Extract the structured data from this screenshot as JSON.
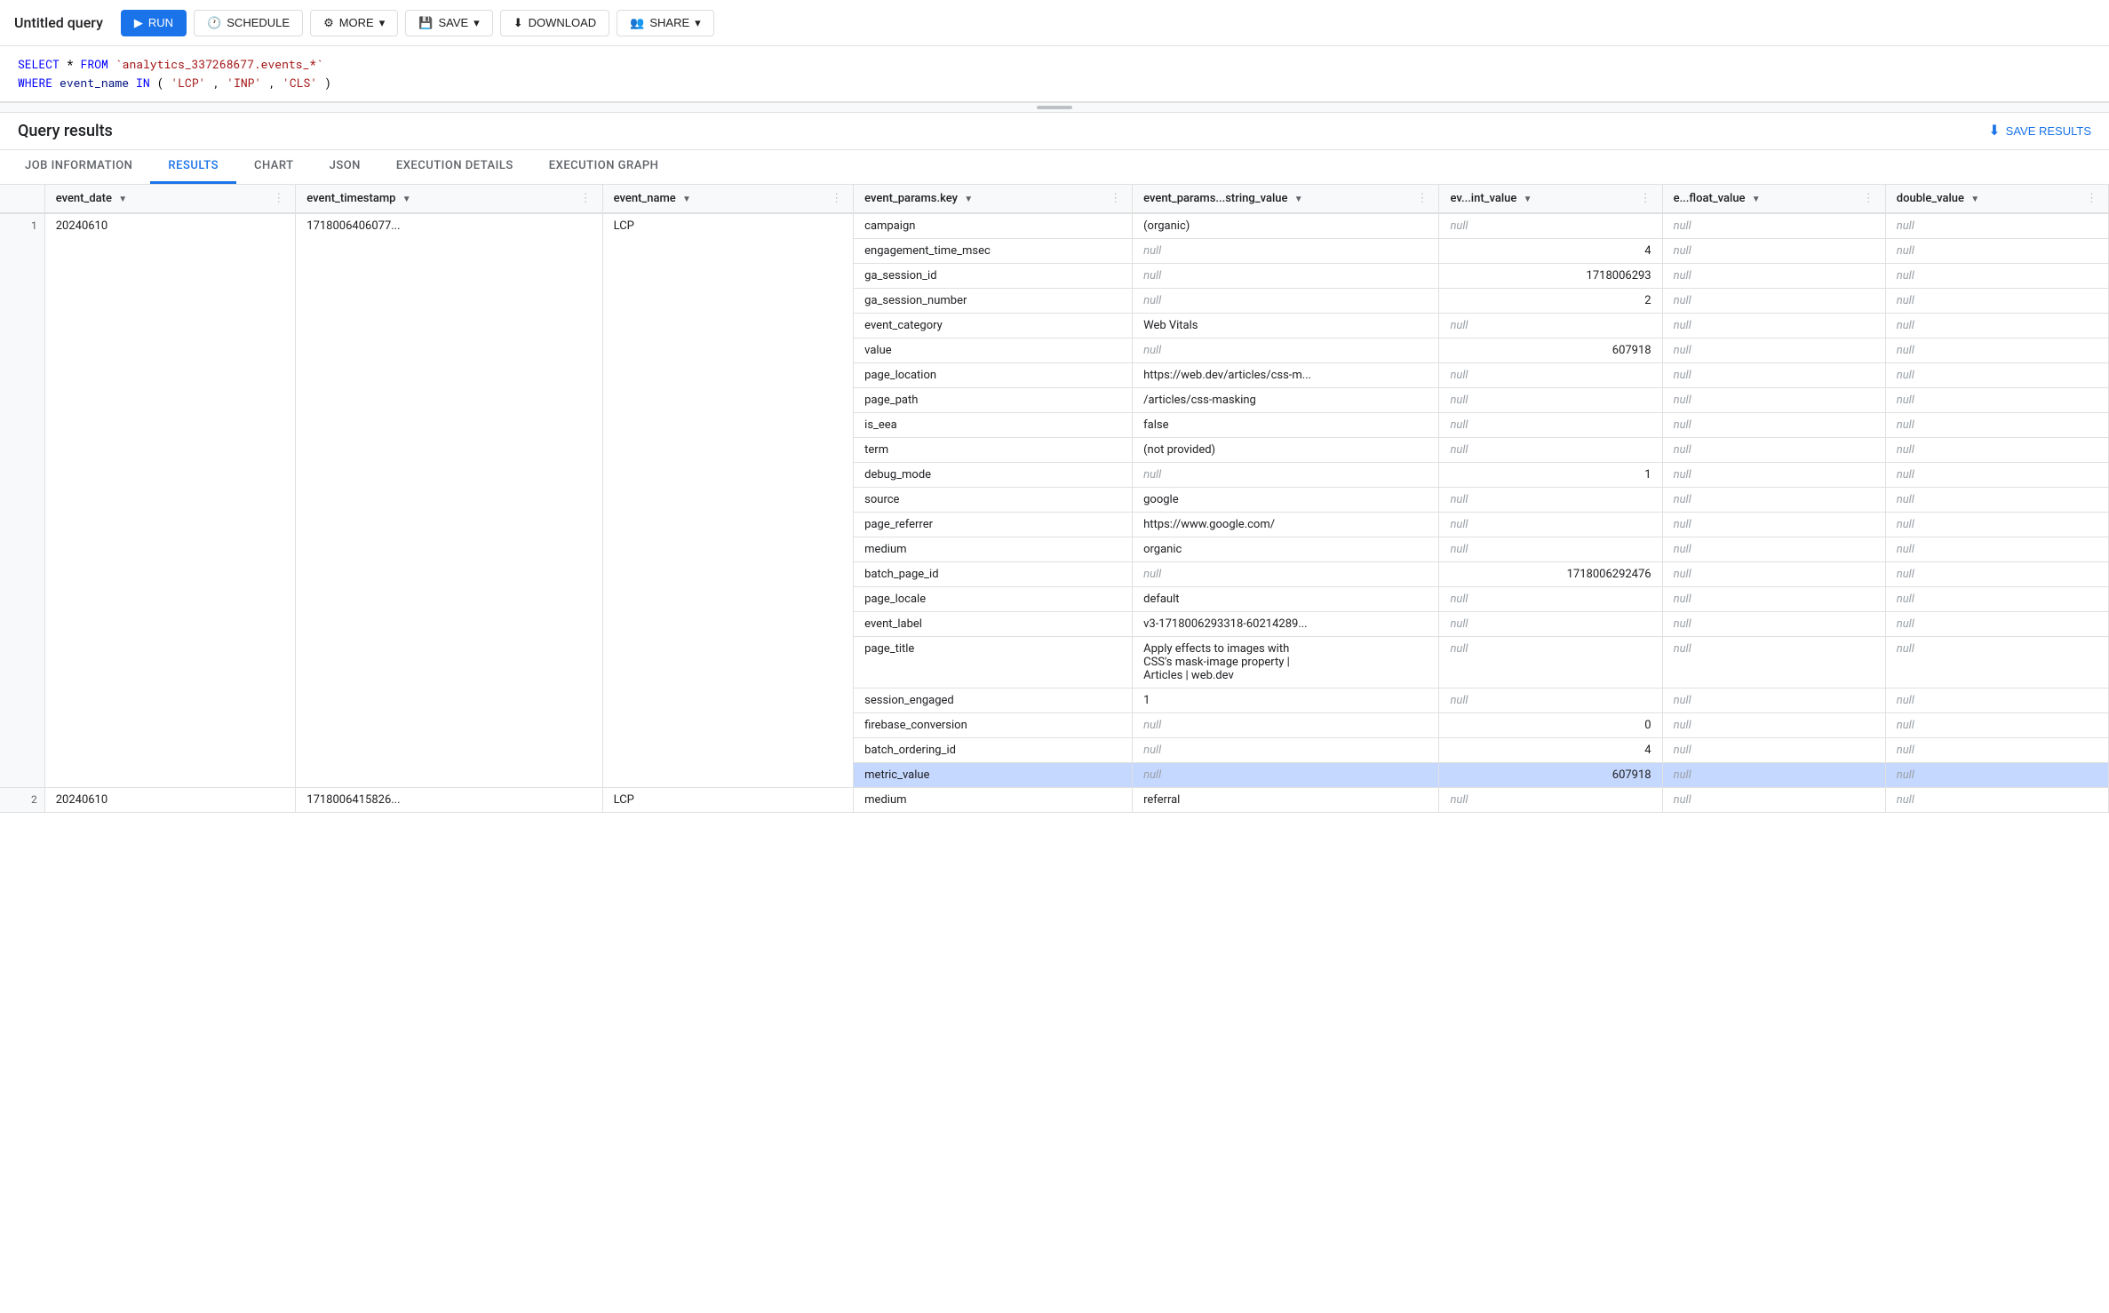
{
  "title": "Untitled query",
  "toolbar": {
    "run_label": "RUN",
    "schedule_label": "SCHEDULE",
    "more_label": "MORE",
    "save_label": "SAVE",
    "download_label": "DOWNLOAD",
    "share_label": "SHARE"
  },
  "query": {
    "line1": "SELECT * FROM `analytics_337268677.events_*`",
    "line2": "WHERE event_name IN ('LCP', 'INP', 'CLS')"
  },
  "results": {
    "title": "Query results",
    "save_results_label": "SAVE RESULTS"
  },
  "tabs": [
    {
      "label": "JOB INFORMATION",
      "active": false
    },
    {
      "label": "RESULTS",
      "active": true
    },
    {
      "label": "CHART",
      "active": false
    },
    {
      "label": "JSON",
      "active": false
    },
    {
      "label": "EXECUTION DETAILS",
      "active": false
    },
    {
      "label": "EXECUTION GRAPH",
      "active": false
    }
  ],
  "columns": {
    "row_num": "#",
    "event_date": "event_date",
    "event_timestamp": "event_timestamp",
    "event_name": "event_name",
    "event_params_key": "event_params.key",
    "event_params_string_value": "event_params...string_value",
    "event_params_int_value": "ev...int_value",
    "event_params_float_value": "e...float_value",
    "double_value": "double_value"
  },
  "rows": [
    {
      "row_num": "1",
      "event_date": "20240610",
      "event_timestamp": "1718006406077...",
      "event_name": "LCP",
      "params": [
        {
          "key": "campaign",
          "string_value": "(organic)",
          "int_value": "null",
          "float_value": "null",
          "double_value": "null"
        },
        {
          "key": "engagement_time_msec",
          "string_value": "null",
          "int_value": "4",
          "float_value": "null",
          "double_value": "null"
        },
        {
          "key": "ga_session_id",
          "string_value": "null",
          "int_value": "1718006293",
          "float_value": "null",
          "double_value": "null"
        },
        {
          "key": "ga_session_number",
          "string_value": "null",
          "int_value": "2",
          "float_value": "null",
          "double_value": "null"
        },
        {
          "key": "event_category",
          "string_value": "Web Vitals",
          "int_value": "null",
          "float_value": "null",
          "double_value": "null"
        },
        {
          "key": "value",
          "string_value": "null",
          "int_value": "607918",
          "float_value": "null",
          "double_value": "null"
        },
        {
          "key": "page_location",
          "string_value": "https://web.dev/articles/css-m...",
          "int_value": "null",
          "float_value": "null",
          "double_value": "null"
        },
        {
          "key": "page_path",
          "string_value": "/articles/css-masking",
          "int_value": "null",
          "float_value": "null",
          "double_value": "null"
        },
        {
          "key": "is_eea",
          "string_value": "false",
          "int_value": "null",
          "float_value": "null",
          "double_value": "null"
        },
        {
          "key": "term",
          "string_value": "(not provided)",
          "int_value": "null",
          "float_value": "null",
          "double_value": "null"
        },
        {
          "key": "debug_mode",
          "string_value": "null",
          "int_value": "1",
          "float_value": "null",
          "double_value": "null"
        },
        {
          "key": "source",
          "string_value": "google",
          "int_value": "null",
          "float_value": "null",
          "double_value": "null"
        },
        {
          "key": "page_referrer",
          "string_value": "https://www.google.com/",
          "int_value": "null",
          "float_value": "null",
          "double_value": "null"
        },
        {
          "key": "medium",
          "string_value": "organic",
          "int_value": "null",
          "float_value": "null",
          "double_value": "null"
        },
        {
          "key": "batch_page_id",
          "string_value": "null",
          "int_value": "1718006292476",
          "float_value": "null",
          "double_value": "null"
        },
        {
          "key": "page_locale",
          "string_value": "default",
          "int_value": "null",
          "float_value": "null",
          "double_value": "null"
        },
        {
          "key": "event_label",
          "string_value": "v3-1718006293318-60214289...",
          "int_value": "null",
          "float_value": "null",
          "double_value": "null"
        },
        {
          "key": "page_title",
          "string_value": "Apply effects to images with\nCSS's mask-image property  |\nArticles | web.dev",
          "int_value": "null",
          "float_value": "null",
          "double_value": "null"
        },
        {
          "key": "session_engaged",
          "string_value": "1",
          "int_value": "null",
          "float_value": "null",
          "double_value": "null"
        },
        {
          "key": "firebase_conversion",
          "string_value": "null",
          "int_value": "0",
          "float_value": "null",
          "double_value": "null"
        },
        {
          "key": "batch_ordering_id",
          "string_value": "null",
          "int_value": "4",
          "float_value": "null",
          "double_value": "null"
        },
        {
          "key": "metric_value",
          "string_value": "null",
          "int_value": "607918",
          "float_value": "null",
          "double_value": "null",
          "highlighted": true
        }
      ]
    },
    {
      "row_num": "2",
      "event_date": "20240610",
      "event_timestamp": "1718006415826...",
      "event_name": "LCP",
      "params": [
        {
          "key": "medium",
          "string_value": "referral",
          "int_value": "null",
          "float_value": "null",
          "double_value": "null"
        }
      ]
    }
  ],
  "colors": {
    "blue": "#1a73e8",
    "light_blue": "#e8f0fe",
    "highlight_blue": "#c5d8ff",
    "border": "#e0e0e0",
    "bg_light": "#f8f9fa",
    "null_color": "#9aa0a6",
    "green": "#0d652d",
    "code_kw": "#0000ff",
    "code_str": "#a31515"
  }
}
